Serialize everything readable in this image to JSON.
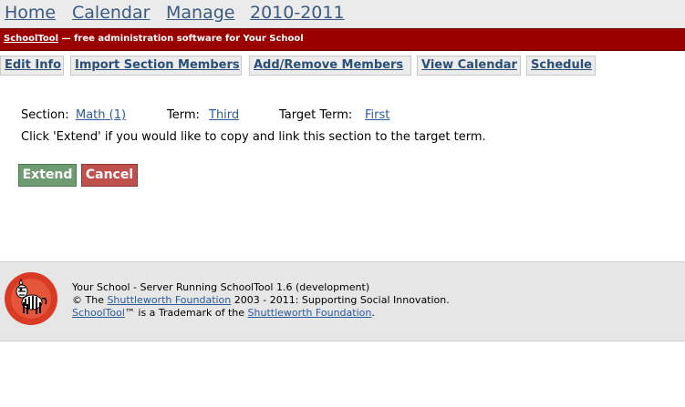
{
  "topnav": {
    "items": [
      "Home",
      "Calendar",
      "Manage",
      "2010-2011"
    ]
  },
  "brand": {
    "link": "SchoolTool",
    "tagline": " — free administration software for Your School"
  },
  "tabs": [
    "Edit Info",
    "Import Section Members",
    "Add/Remove Members",
    "View Calendar",
    "Schedule"
  ],
  "form": {
    "section_label": "Section:",
    "section_value": "Math (1)",
    "term_label": "Term:",
    "term_value": "Third",
    "target_label": "Target Term:",
    "target_value": "First",
    "instruction": "Click 'Extend' if you would like to copy and link this section to the target term.",
    "extend_label": "Extend",
    "cancel_label": "Cancel"
  },
  "footer": {
    "line1": "Your School - Server Running SchoolTool 1.6 (development)",
    "line2_prefix": "© The ",
    "line2_link": "Shuttleworth Foundation",
    "line2_suffix": " 2003 - 2011: Supporting Social Innovation.",
    "line3_link1": "SchoolTool",
    "line3_middle": "™ is a Trademark of the ",
    "line3_link2": "Shuttleworth Foundation",
    "line3_suffix": ".",
    "logo_icon": "zebra-logo-icon"
  },
  "colors": {
    "brand_red": "#9b0000",
    "extend_green": "#6f9b73",
    "cancel_red": "#c0504e",
    "link_blue": "#2a5a9a"
  }
}
